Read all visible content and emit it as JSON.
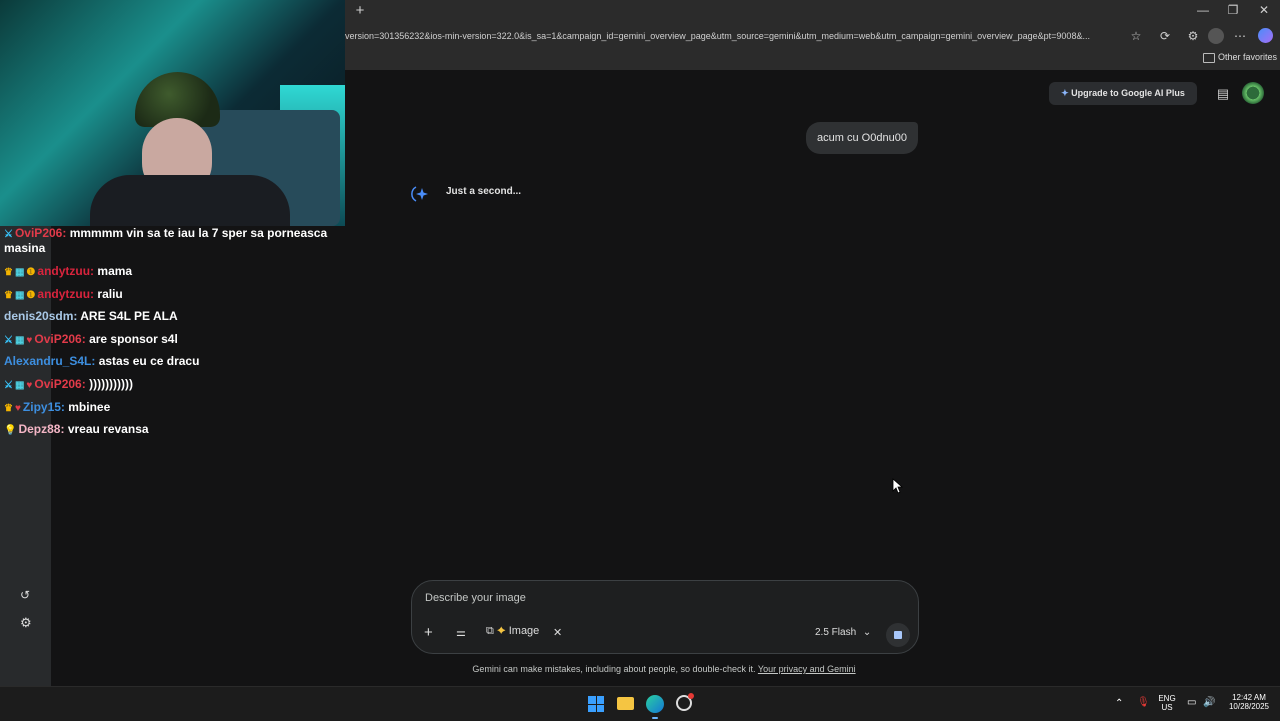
{
  "browser": {
    "new_tab_glyph": "+",
    "url": "version=301356232&ios-min-version=322.0&is_sa=1&campaign_id=gemini_overview_page&utm_source=gemini&utm_medium=web&utm_campaign=gemini_overview_page&pt=9008&...",
    "other_favorites": "Other favorites",
    "window_minimize": "—",
    "window_restore": "❐",
    "window_close": "✕"
  },
  "chat": {
    "messages": [
      {
        "user": "OviP206:",
        "text": "mmmmm vin sa te iau la 7 sper sa porneasca",
        "text2": "masina",
        "user_color": "#e23b4a"
      },
      {
        "user": "andytzuu:",
        "text": "mama",
        "user_color": "#d9243d"
      },
      {
        "user": "andytzuu:",
        "text": "raliu",
        "user_color": "#d9243d"
      },
      {
        "user": "denis20sdm:",
        "text": "ARE S4L PE ALA",
        "user_color": "#a9c8e6"
      },
      {
        "user": "OviP206:",
        "text": "are sponsor s4l",
        "user_color": "#e23b4a"
      },
      {
        "user": "Alexandru_S4L:",
        "text": "astas eu ce dracu",
        "user_color": "#3d8fe0"
      },
      {
        "user": "OviP206:",
        "text": ")))))))))))",
        "user_color": "#e23b4a"
      },
      {
        "user": "Zipy15:",
        "text": "mbinee",
        "user_color": "#3d8fe0"
      },
      {
        "user": "Depz88:",
        "text": "vreau revansa",
        "user_color": "#f4b6c6"
      }
    ]
  },
  "gemini": {
    "upgrade_label": "Upgrade to Google AI Plus",
    "user_message": "acum cu O0dnu00",
    "thinking_text": "Just a second...",
    "input_placeholder": "Describe your image",
    "image_chip_label": "Image",
    "model_label": "2.5 Flash",
    "disclaimer": "Gemini can make mistakes, including about people, so double-check it.",
    "privacy_link": "Your privacy and Gemini",
    "accent_color": "#4a8df8"
  },
  "taskbar": {
    "lang_top": "ENG",
    "lang_bottom": "US",
    "time": "12:42 AM",
    "date": "10/28/2025"
  }
}
